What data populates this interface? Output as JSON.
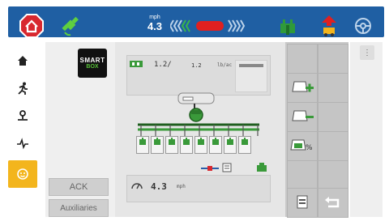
{
  "topbar": {
    "speed_unit": "mph",
    "speed_value": "4.3",
    "colors": {
      "bar": "#1f5fa3",
      "home": "#d8282f",
      "steer_red": "#e02020",
      "steer_green": "#3bb54a",
      "accent_yellow": "#f3b51d"
    },
    "icons": [
      "home-icon",
      "gps-signal-icon",
      "steering-guidance-icon",
      "row-unit-icon",
      "lift-icon",
      "steering-wheel-icon"
    ]
  },
  "sidebar": {
    "items": [
      {
        "icon": "home-icon"
      },
      {
        "icon": "run-icon"
      },
      {
        "icon": "location-icon"
      },
      {
        "icon": "activity-icon"
      },
      {
        "icon": "smiley-icon",
        "active": true
      }
    ]
  },
  "smartbox": {
    "line1": "SMART",
    "line2": "BOX"
  },
  "buttons": {
    "ack": "ACK",
    "auxiliaries": "Auxiliaries"
  },
  "main": {
    "rate_value": "1.2/",
    "rate_target": "1.2",
    "rate_unit": "lb/ac",
    "speed_value": "4.3",
    "speed_unit": "mph",
    "row_count": 8
  },
  "menu": {
    "dots": "⋮"
  }
}
